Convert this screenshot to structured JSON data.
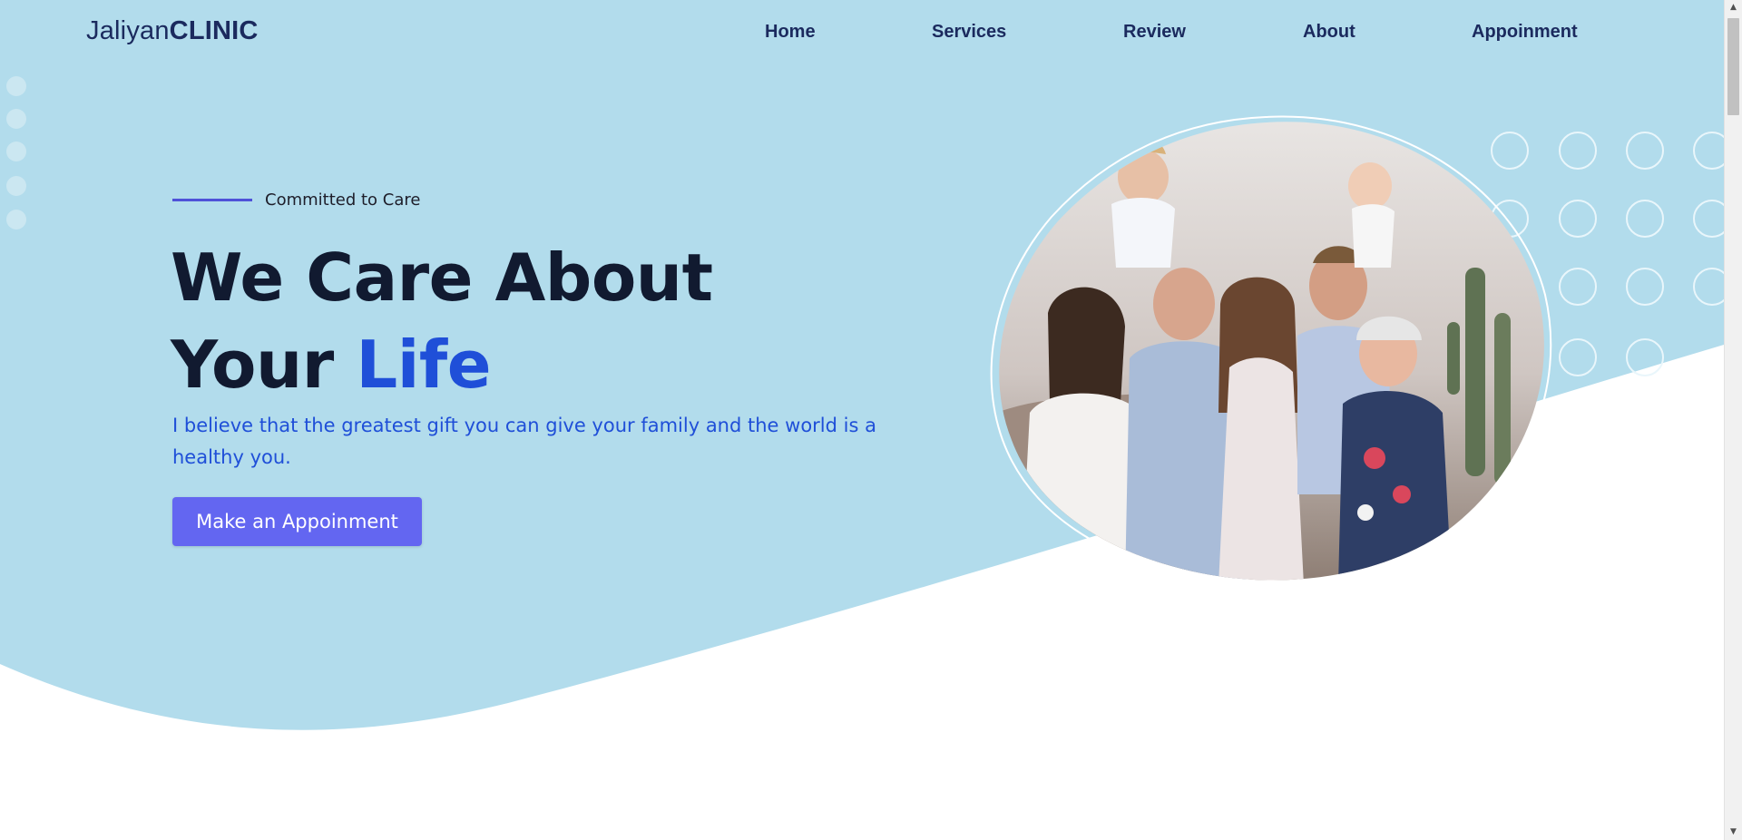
{
  "colors": {
    "hero_bg": "#b2dcec",
    "brand_dark": "#1b2a5e",
    "headline": "#111a30",
    "accent_blue": "#1f4fd8",
    "cta_bg": "#6366f1",
    "tag_line": "#4f51d8"
  },
  "brand": {
    "name_regular": "Jaliyan",
    "name_bold": "CLINIC"
  },
  "nav": {
    "items": [
      {
        "label": "Home"
      },
      {
        "label": "Services"
      },
      {
        "label": "Review"
      },
      {
        "label": "About"
      },
      {
        "label": "Appoinment"
      }
    ]
  },
  "hero": {
    "tagline": "Committed to Care",
    "headline_line1": "We Care About",
    "headline_line2_prefix": "Your ",
    "headline_accent": "Life",
    "lead": "I believe that the greatest gift you can give your family and the world is a healthy you.",
    "cta_label": "Make an Appoinment",
    "image_icon": "family-photo"
  },
  "scrollbar": {
    "up_icon": "arrow-up-icon",
    "down_icon": "arrow-down-icon"
  }
}
